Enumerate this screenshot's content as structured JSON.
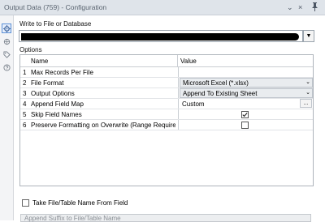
{
  "window": {
    "title": "Output Data (759) - Configuration"
  },
  "sidebar": {
    "icons": [
      "gear-icon",
      "connection-icon",
      "tag-icon",
      "help-icon"
    ]
  },
  "write_to": {
    "label": "Write to File or Database"
  },
  "options": {
    "label": "Options",
    "columns": {
      "name": "Name",
      "value": "Value"
    },
    "rows": [
      {
        "num": "1",
        "name": "Max Records Per File",
        "value": ""
      },
      {
        "num": "2",
        "name": "File Format",
        "value": "Microsoft Excel (*.xlsx)"
      },
      {
        "num": "3",
        "name": "Output Options",
        "value": "Append To Existing Sheet"
      },
      {
        "num": "4",
        "name": "Append Field Map",
        "value": "Custom",
        "button": "..."
      },
      {
        "num": "5",
        "name": "Skip Field Names",
        "checked": true
      },
      {
        "num": "6",
        "name": "Preserve Formatting on Overwrite (Range Required)",
        "checked": false
      }
    ]
  },
  "take_from_field": {
    "label": "Take File/Table Name From Field",
    "checked": false
  },
  "append_suffix": {
    "value": "Append Suffix to File/Table Name"
  }
}
